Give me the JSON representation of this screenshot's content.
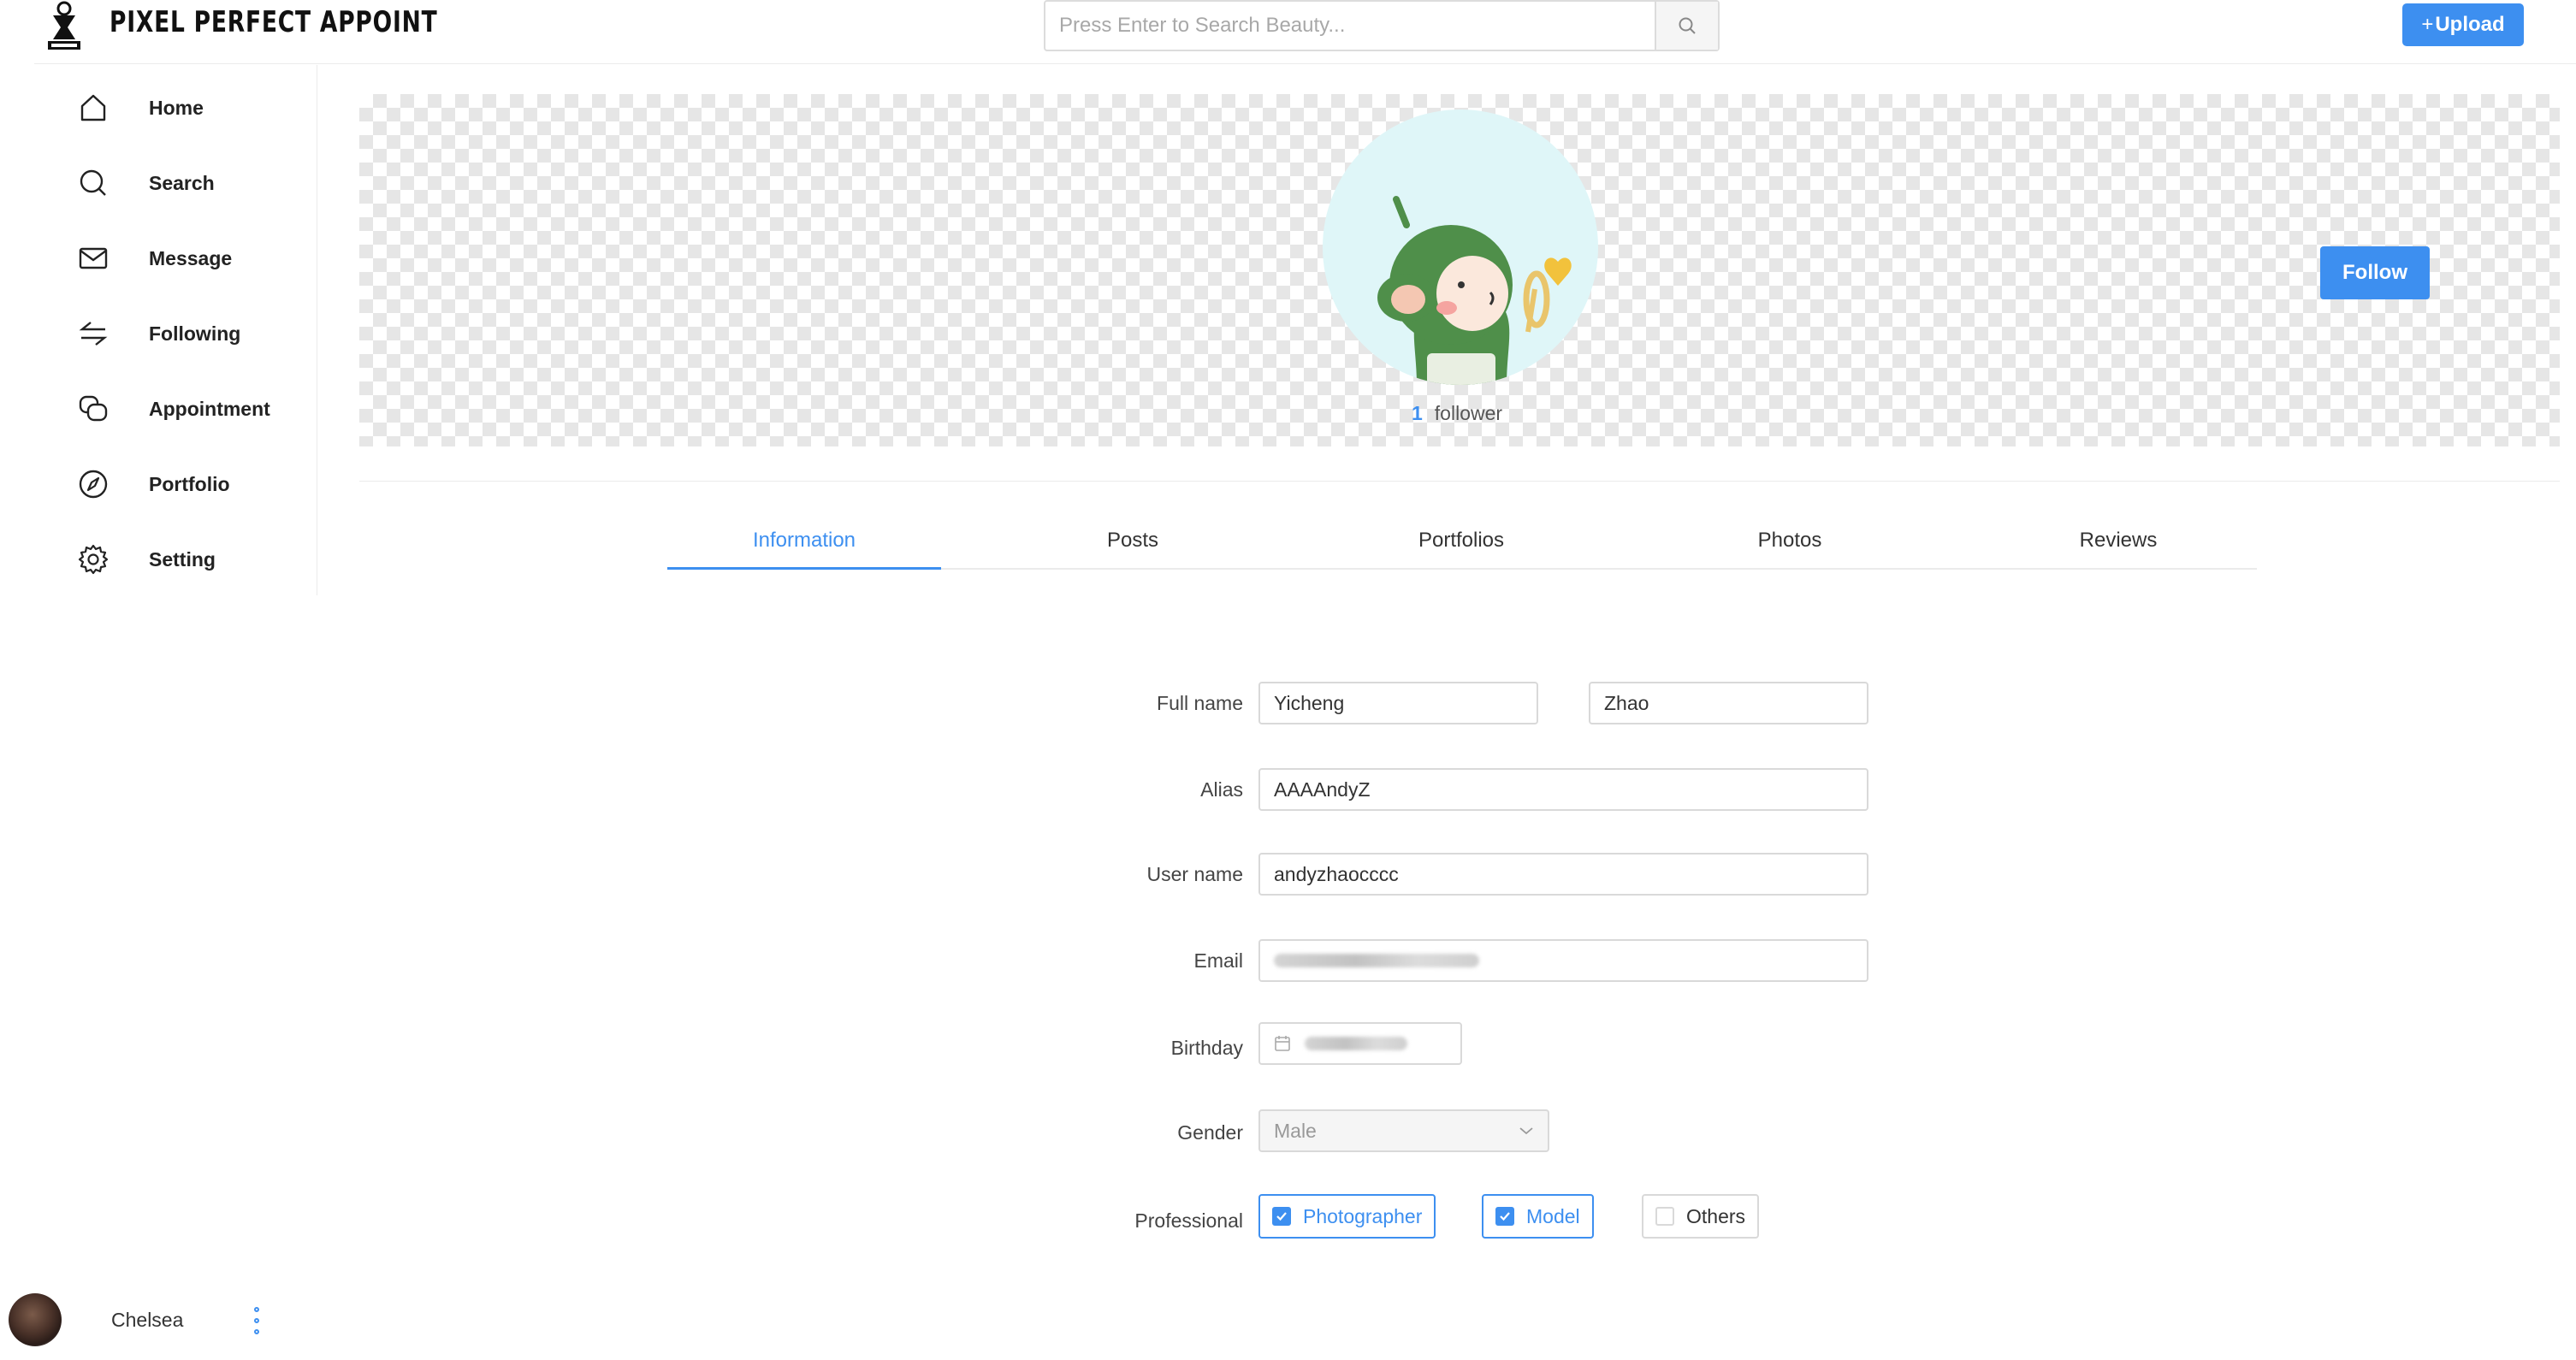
{
  "header": {
    "app_title": "PIXEL PERFECT APPOINT",
    "search_placeholder": "Press Enter to Search Beauty...",
    "upload_label": "Upload",
    "upload_prefix": "+"
  },
  "sidebar": {
    "items": [
      {
        "label": "Home",
        "icon": "home-icon"
      },
      {
        "label": "Search",
        "icon": "search-icon"
      },
      {
        "label": "Message",
        "icon": "mail-icon"
      },
      {
        "label": "Following",
        "icon": "swap-icon"
      },
      {
        "label": "Appointment",
        "icon": "chat-icon"
      },
      {
        "label": "Portfolio",
        "icon": "compass-icon"
      },
      {
        "label": "Setting",
        "icon": "gear-icon"
      }
    ]
  },
  "user": {
    "name": "Chelsea"
  },
  "profile": {
    "follower_count": "1",
    "follower_label": "follower",
    "follow_label": "Follow"
  },
  "tabs": [
    {
      "label": "Information",
      "active": true
    },
    {
      "label": "Posts",
      "active": false
    },
    {
      "label": "Portfolios",
      "active": false
    },
    {
      "label": "Photos",
      "active": false
    },
    {
      "label": "Reviews",
      "active": false
    }
  ],
  "form": {
    "full_name_label": "Full name",
    "first_name": "Yicheng",
    "last_name": "Zhao",
    "alias_label": "Alias",
    "alias": "AAAAndyZ",
    "username_label": "User name",
    "username": "andyzhaocccc",
    "email_label": "Email",
    "birthday_label": "Birthday",
    "gender_label": "Gender",
    "gender": "Male",
    "professional_label": "Professional",
    "professional_options": [
      {
        "label": "Photographer",
        "checked": true
      },
      {
        "label": "Model",
        "checked": true
      },
      {
        "label": "Others",
        "checked": false
      }
    ]
  },
  "colors": {
    "accent": "#3d8ff0",
    "border": "#d9d9d9",
    "avatar_bg": "#dff6f8",
    "mascot_green": "#4f8f4a"
  }
}
